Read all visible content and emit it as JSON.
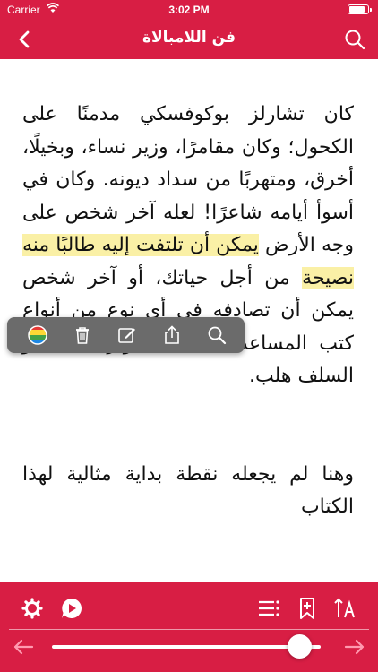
{
  "status_bar": {
    "carrier": "Carrier",
    "time": "3:02 PM",
    "battery_level": 0.9
  },
  "nav": {
    "title": "فن اللامبالاة",
    "back_icon": "chevron-left-icon",
    "search_icon": "search-icon"
  },
  "reader": {
    "text_before": "كان تشارلز بوكوفسكي مدمنًا على الكحول؛ وكان مقامرًا، وزير نساء، وبخيلًا، أخرق، ومتهربًا من سداد ديونه. وكان في أسوأ أيامه شاعرًا! لعله آخر شخص على وجه الأرض ",
    "highlighted": "يمكن أن تلتفت إليه طالبًا منه نصيحة",
    "text_after": " من أجل حياتك، أو آخر شخص يمكن أن تصادفه في أي نوع من أنواع كتب المساعدة الذاتية تطوير الذات أو السلف هلب.",
    "next_paragraph": "وهنا لم يجعله نقطة بداية مثالية لهذا الكتاب"
  },
  "selection_menu": {
    "items": [
      "color-picker-icon",
      "trash-icon",
      "edit-note-icon",
      "share-icon",
      "search-icon"
    ],
    "colors": [
      "#e53935",
      "#fdd835",
      "#43a047",
      "#1e88e5"
    ]
  },
  "toolbar": {
    "left_icons": [
      "settings-gear-icon",
      "audio-play-icon"
    ],
    "right_icons": [
      "list-icon",
      "bookmark-add-icon",
      "font-size-icon"
    ],
    "progress": 0.92,
    "prev_icon": "arrow-left-icon",
    "next_icon": "arrow-right-icon"
  },
  "colors": {
    "accent": "#d81e44",
    "highlight": "#faf0a6",
    "popup_bg": "#6b6b6b"
  }
}
